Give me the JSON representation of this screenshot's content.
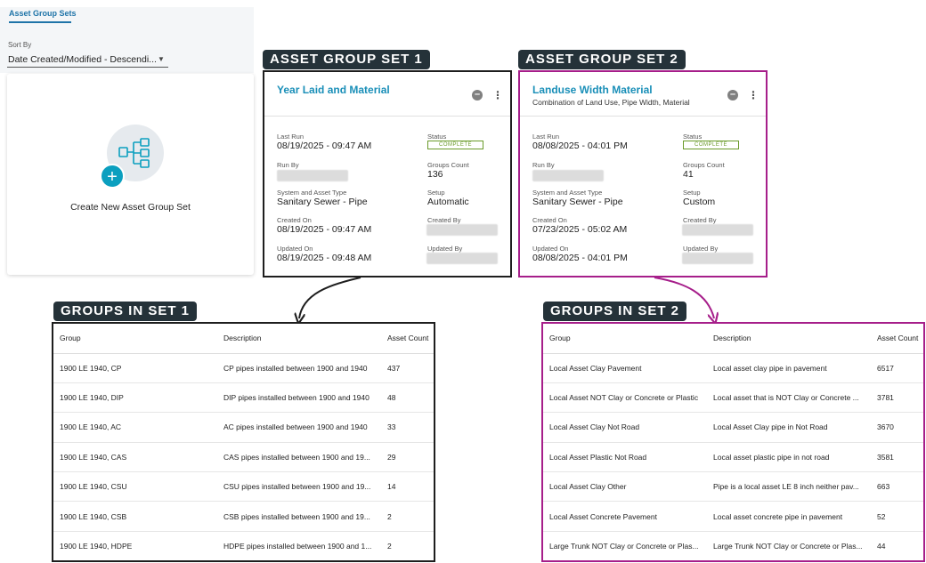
{
  "sidebar": {
    "tab_label": "Asset Group Sets",
    "sort_label": "Sort By",
    "sort_value": "Date Created/Modified - Descendi...",
    "create_label": "Create New Asset Group Set"
  },
  "badges": {
    "set1": "ASSET GROUP SET 1",
    "set2": "ASSET GROUP SET 2",
    "groups1": "GROUPS IN SET 1",
    "groups2": "GROUPS IN SET 2"
  },
  "colors": {
    "accent": "#1a8fb8",
    "set2_border": "#a61e8a",
    "badge_bg": "#253239",
    "status_green": "#6a9a2a"
  },
  "labels": {
    "last_run": "Last Run",
    "status": "Status",
    "run_by": "Run By",
    "groups_count": "Groups Count",
    "system_asset_type": "System and Asset Type",
    "setup": "Setup",
    "created_on": "Created On",
    "created_by": "Created By",
    "updated_on": "Updated On",
    "updated_by": "Updated By"
  },
  "set1": {
    "title": "Year Laid and Material",
    "subtitle": "",
    "last_run": "08/19/2025 - 09:47 AM",
    "status": "COMPLETE",
    "groups_count": "136",
    "system_asset_type": "Sanitary Sewer - Pipe",
    "setup": "Automatic",
    "created_on": "08/19/2025 - 09:47 AM",
    "updated_on": "08/19/2025 - 09:48 AM"
  },
  "set2": {
    "title": "Landuse Width Material",
    "subtitle": "Combination of Land Use, Pipe Width, Material",
    "last_run": "08/08/2025 - 04:01 PM",
    "status": "COMPLETE",
    "groups_count": "41",
    "system_asset_type": "Sanitary Sewer - Pipe",
    "setup": "Custom",
    "created_on": "07/23/2025 - 05:02 AM",
    "updated_on": "08/08/2025 - 04:01 PM"
  },
  "table_headers": {
    "group": "Group",
    "description": "Description",
    "asset_count": "Asset Count"
  },
  "table1": [
    {
      "group": "1900 LE 1940, CP",
      "description": "CP pipes installed between 1900 and 1940",
      "count": "437"
    },
    {
      "group": "1900 LE 1940, DIP",
      "description": "DIP pipes installed between 1900 and 1940",
      "count": "48"
    },
    {
      "group": "1900 LE 1940, AC",
      "description": "AC pipes installed between 1900 and 1940",
      "count": "33"
    },
    {
      "group": "1900 LE 1940, CAS",
      "description": "CAS pipes installed between 1900 and 19...",
      "count": "29"
    },
    {
      "group": "1900 LE 1940, CSU",
      "description": "CSU pipes installed between 1900 and 19...",
      "count": "14"
    },
    {
      "group": "1900 LE 1940, CSB",
      "description": "CSB pipes installed between 1900 and 19...",
      "count": "2"
    },
    {
      "group": "1900 LE 1940, HDPE",
      "description": "HDPE pipes installed between 1900 and 1...",
      "count": "2"
    }
  ],
  "table2": [
    {
      "group": "Local Asset Clay Pavement",
      "description": "Local asset clay pipe in pavement",
      "count": "6517"
    },
    {
      "group": "Local Asset NOT Clay or Concrete or Plastic",
      "description": "Local asset that is NOT Clay or Concrete ...",
      "count": "3781"
    },
    {
      "group": "Local Asset Clay Not Road",
      "description": "Local Asset Clay pipe in Not Road",
      "count": "3670"
    },
    {
      "group": "Local Asset Plastic Not Road",
      "description": "Local asset plastic pipe in not road",
      "count": "3581"
    },
    {
      "group": "Local Asset Clay Other",
      "description": "Pipe is a local asset LE 8 inch neither pav...",
      "count": "663"
    },
    {
      "group": "Local Asset Concrete Pavement",
      "description": "Local asset concrete pipe in pavement",
      "count": "52"
    },
    {
      "group": "Large Trunk NOT Clay or Concrete or Plas...",
      "description": "Large Trunk NOT Clay or Concrete or Plas...",
      "count": "44"
    }
  ]
}
